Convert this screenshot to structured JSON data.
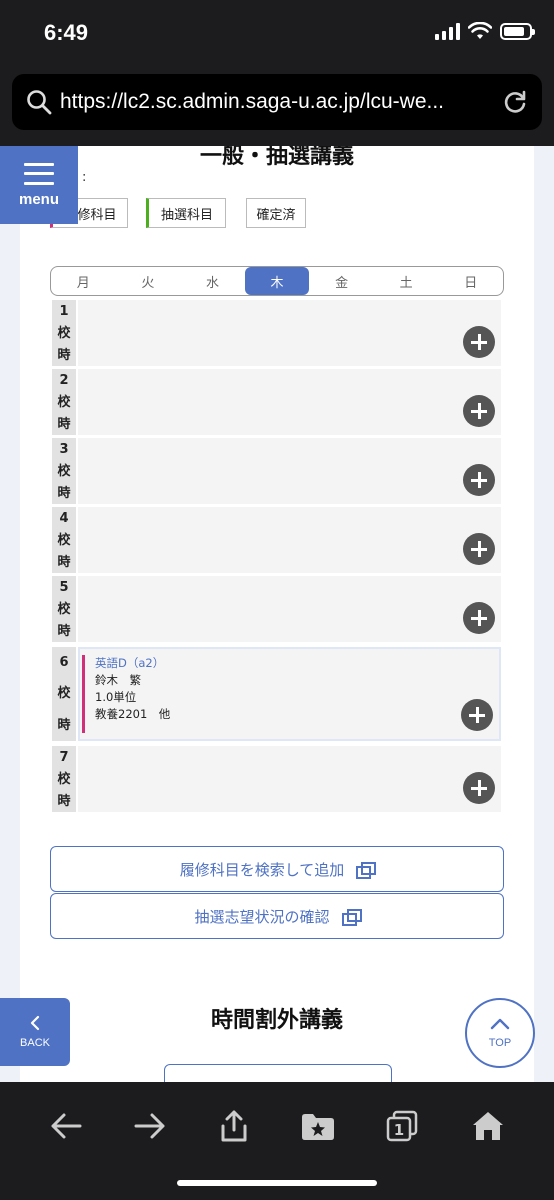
{
  "status": {
    "time": "6:49"
  },
  "browser": {
    "url": "https://lc2.sc.admin.saga-u.ac.jp/lcu-we..."
  },
  "menu": {
    "label": "menu"
  },
  "section": {
    "title": "一般・抽選講義",
    "legend_colon": ":"
  },
  "legend": {
    "required": "修科目",
    "lottery": "抽選科目",
    "confirmed": "確定済"
  },
  "days": [
    "月",
    "火",
    "水",
    "木",
    "金",
    "土",
    "日"
  ],
  "active_day": "木",
  "periods": [
    {
      "num": "1",
      "k": "校",
      "j": "時"
    },
    {
      "num": "2",
      "k": "校",
      "j": "時"
    },
    {
      "num": "3",
      "k": "校",
      "j": "時"
    },
    {
      "num": "4",
      "k": "校",
      "j": "時"
    },
    {
      "num": "5",
      "k": "校",
      "j": "時"
    },
    {
      "num": "6",
      "k": "校",
      "j": "時"
    },
    {
      "num": "7",
      "k": "校",
      "j": "時"
    }
  ],
  "course": {
    "name": "英語D（a2）",
    "teacher": "鈴木　繁",
    "credits": "1.0単位",
    "room": "教養2201　他"
  },
  "actions": {
    "search_add": "履修科目を検索して追加",
    "lottery_status": "抽選志望状況の確認"
  },
  "section2": {
    "title": "時間割外講義"
  },
  "nav": {
    "back": "BACK",
    "top": "TOP"
  },
  "toolbar": {
    "tabs_count": "1"
  },
  "colors": {
    "accent": "#4f72c4",
    "required": "#d0307a",
    "lottery": "#4caf1e"
  }
}
